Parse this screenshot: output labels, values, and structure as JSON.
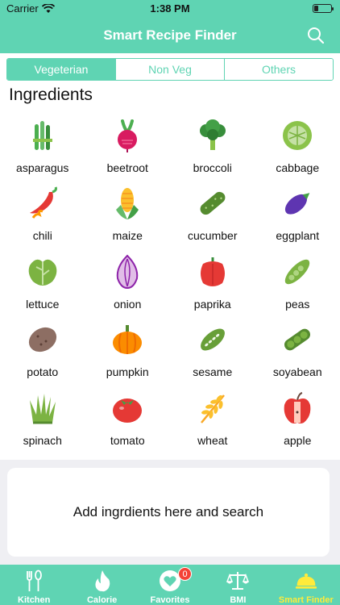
{
  "status_bar": {
    "carrier": "Carrier",
    "time": "1:38 PM"
  },
  "nav": {
    "title": "Smart Recipe Finder",
    "search_icon": "search-icon"
  },
  "segments": [
    {
      "label": "Vegeterian",
      "active": true
    },
    {
      "label": "Non Veg",
      "active": false
    },
    {
      "label": "Others",
      "active": false
    }
  ],
  "section_title": "Ingredients",
  "ingredients": [
    {
      "label": "asparagus",
      "icon": "asparagus-icon"
    },
    {
      "label": "beetroot",
      "icon": "beetroot-icon"
    },
    {
      "label": "broccoli",
      "icon": "broccoli-icon"
    },
    {
      "label": "cabbage",
      "icon": "cabbage-icon"
    },
    {
      "label": "chili",
      "icon": "chili-icon"
    },
    {
      "label": "maize",
      "icon": "maize-icon"
    },
    {
      "label": "cucumber",
      "icon": "cucumber-icon"
    },
    {
      "label": "eggplant",
      "icon": "eggplant-icon"
    },
    {
      "label": "lettuce",
      "icon": "lettuce-icon"
    },
    {
      "label": "onion",
      "icon": "onion-icon"
    },
    {
      "label": "paprika",
      "icon": "paprika-icon"
    },
    {
      "label": "peas",
      "icon": "peas-icon"
    },
    {
      "label": "potato",
      "icon": "potato-icon"
    },
    {
      "label": "pumpkin",
      "icon": "pumpkin-icon"
    },
    {
      "label": "sesame",
      "icon": "sesame-icon"
    },
    {
      "label": "soyabean",
      "icon": "soyabean-icon"
    },
    {
      "label": "spinach",
      "icon": "spinach-icon"
    },
    {
      "label": "tomato",
      "icon": "tomato-icon"
    },
    {
      "label": "wheat",
      "icon": "wheat-icon"
    },
    {
      "label": "apple",
      "icon": "apple-icon"
    }
  ],
  "search_card": {
    "text": "Add ingrdients here and search"
  },
  "tabbar": {
    "tabs": [
      {
        "label": "Kitchen",
        "icon": "fork-spoon-icon",
        "active": false
      },
      {
        "label": "Calorie",
        "icon": "flame-icon",
        "active": false
      },
      {
        "label": "Favorites",
        "icon": "heart-icon",
        "active": false,
        "badge": "0"
      },
      {
        "label": "BMI",
        "icon": "scale-icon",
        "active": false
      },
      {
        "label": "Smart Finder",
        "icon": "cloche-icon",
        "active": true
      }
    ]
  },
  "colors": {
    "accent": "#5fd4b3",
    "active_tab": "#ffeb3b",
    "badge": "#f44336"
  }
}
